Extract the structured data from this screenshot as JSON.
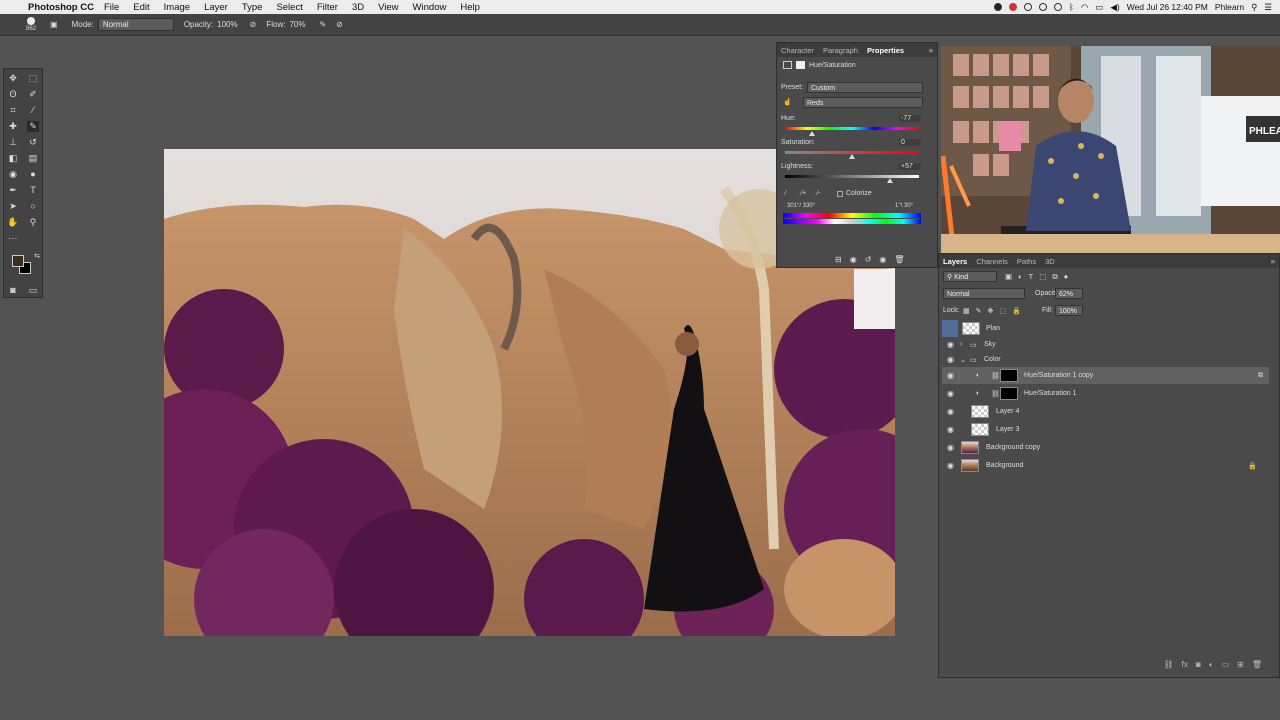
{
  "menubar": {
    "app": "Photoshop CC",
    "items": [
      "File",
      "Edit",
      "Image",
      "Layer",
      "Type",
      "Select",
      "Filter",
      "3D",
      "View",
      "Window",
      "Help"
    ],
    "clock": "Wed Jul 26  12:40 PM",
    "user": "Phlearn"
  },
  "options": {
    "brush_size": "862",
    "mode_label": "Mode:",
    "mode_value": "Normal",
    "opacity_label": "Opacity:",
    "opacity_value": "100%",
    "flow_label": "Flow:",
    "flow_value": "70%"
  },
  "properties": {
    "tabs": [
      "Character",
      "Paragraph",
      "Properties"
    ],
    "title": "Hue/Saturation",
    "preset_label": "Preset:",
    "preset_value": "Custom",
    "channel_value": "Reds",
    "hue_label": "Hue:",
    "hue_value": "-77",
    "saturation_label": "Saturation:",
    "saturation_value": "0",
    "lightness_label": "Lightness:",
    "lightness_value": "+57",
    "colorize_label": "Colorize",
    "range_left": "301°/ 330°",
    "range_right": "1°\\ 30°"
  },
  "layers": {
    "tabs": [
      "Layers",
      "Channels",
      "Paths",
      "3D"
    ],
    "kind_label": "Kind",
    "blend_mode": "Normal",
    "opacity_label": "Opacity:",
    "opacity_value": "62%",
    "lock_label": "Lock:",
    "fill_label": "Fill:",
    "fill_value": "100%",
    "items": [
      {
        "name": "Plan"
      },
      {
        "name": "Sky"
      },
      {
        "name": "Color"
      },
      {
        "name": "Hue/Saturation 1 copy"
      },
      {
        "name": "Hue/Saturation 1"
      },
      {
        "name": "Layer 4"
      },
      {
        "name": "Layer 3"
      },
      {
        "name": "Background copy"
      },
      {
        "name": "Background"
      }
    ]
  },
  "video": {
    "sign_text": "PHLEA"
  },
  "colors": {
    "foreground": "#3a2e1c",
    "background": "#000000",
    "accent": "#4d7ab4"
  }
}
